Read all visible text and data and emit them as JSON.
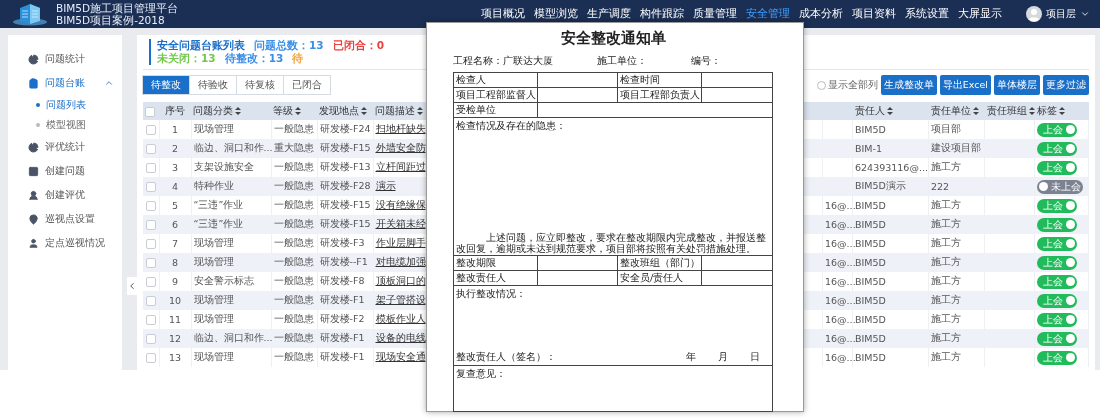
{
  "header": {
    "title": "BIM5D施工项目管理平台",
    "subtitle": "BIM5D项目案例-2018",
    "user": "项目层",
    "nav": [
      {
        "label": "项目概况",
        "selected": false
      },
      {
        "label": "模型浏览",
        "selected": false
      },
      {
        "label": "生产调度",
        "selected": false
      },
      {
        "label": "构件跟踪",
        "selected": false
      },
      {
        "label": "质量管理",
        "selected": false
      },
      {
        "label": "安全管理",
        "selected": true
      },
      {
        "label": "成本分析",
        "selected": false
      },
      {
        "label": "项目资料",
        "selected": false
      },
      {
        "label": "系统设置",
        "selected": false
      },
      {
        "label": "大屏显示",
        "selected": false
      }
    ]
  },
  "sidebar": [
    {
      "label": "问题统计",
      "selected": false,
      "expanded": false
    },
    {
      "label": "问题台账",
      "selected": false,
      "expanded": true,
      "children": [
        {
          "label": "问题列表",
          "selected": true
        },
        {
          "label": "模型视图",
          "selected": false
        }
      ]
    },
    {
      "label": "评优统计",
      "selected": false,
      "expanded": false
    },
    {
      "label": "创建问题",
      "selected": false,
      "expanded": false
    },
    {
      "label": "创建评优",
      "selected": false,
      "expanded": false
    },
    {
      "label": "巡视点设置",
      "selected": false,
      "expanded": false
    },
    {
      "label": "定点巡视情况",
      "selected": false,
      "expanded": false
    }
  ],
  "list": {
    "title": "安全问题台账列表",
    "stats": [
      {
        "label": "问题总数：13",
        "color": "#3a8ee6"
      },
      {
        "label": "已闭合：0",
        "color": "#e8423f"
      },
      {
        "label": "未关闭：13",
        "color": "#74c64c"
      },
      {
        "label": "待整改：13",
        "color": "#3a8ee6"
      },
      {
        "label": "待",
        "color": "#f2a23a"
      }
    ],
    "tabs": [
      {
        "label": "待整改",
        "selected": true
      },
      {
        "label": "待验收",
        "selected": false
      },
      {
        "label": "待复核",
        "selected": false
      },
      {
        "label": "已闭合",
        "selected": false
      }
    ],
    "show_all_columns": {
      "label": "显示全部列",
      "checked": false
    },
    "buttons": [
      "生成整改单",
      "导出Excel",
      "单体楼层",
      "更多过滤"
    ],
    "table": {
      "header_checked": false,
      "columns": [
        {
          "label": "序号",
          "sortable": false
        },
        {
          "label": "问题分类",
          "sortable": true
        },
        {
          "label": "等级",
          "sortable": true
        },
        {
          "label": "发现地点",
          "sortable": true
        },
        {
          "label": "问题描述",
          "sortable": true
        },
        {
          "label": "责任人",
          "sortable": true
        },
        {
          "label": "责任单位",
          "sortable": true
        },
        {
          "label": "责任班组",
          "sortable": true
        },
        {
          "label": "标签",
          "sortable": true
        }
      ],
      "rows": [
        {
          "checked": false,
          "cells": [
            "1",
            "现场管理",
            "一般隐患",
            "研发楼-F24",
            "扫地杆缺失"
          ],
          "assignee": "BIM5D",
          "unit": "项目部",
          "tag": {
            "label": "上会",
            "on": true
          }
        },
        {
          "checked": false,
          "cells": [
            "2",
            "临边、洞口和作...",
            "重大隐患",
            "研发楼-F15",
            "外墙安全防"
          ],
          "assignee": "BIM-1",
          "unit": "建设项目部",
          "tag": {
            "label": "上会",
            "on": true
          }
        },
        {
          "checked": false,
          "cells": [
            "3",
            "支架设施安全",
            "一般隐患",
            "研发楼-F13",
            "立杆间距过"
          ],
          "assignee": "624393116@...",
          "unit": "施工方",
          "tag": {
            "label": "上会",
            "on": true
          }
        },
        {
          "checked": false,
          "cells": [
            "4",
            "特种作业",
            "一般隐患",
            "研发楼-F28",
            "演示"
          ],
          "assignee": "BIM5D演示",
          "unit": "222",
          "tag": {
            "label": "未上会",
            "on": false
          }
        },
        {
          "checked": false,
          "cells": [
            "5",
            "“三违”作业",
            "一般隐患",
            "研发楼-F15",
            "没有绝缘保"
          ],
          "column_7": "16@...",
          "assignee": "BIM5D",
          "unit": "施工方",
          "tag": {
            "label": "上会",
            "on": true
          }
        },
        {
          "checked": false,
          "cells": [
            "6",
            "“三违”作业",
            "一般隐患",
            "研发楼-F15",
            "开关箱未经"
          ],
          "column_7": "16@...",
          "assignee": "BIM5D",
          "unit": "施工方",
          "tag": {
            "label": "上会",
            "on": true
          }
        },
        {
          "checked": false,
          "cells": [
            "7",
            "现场管理",
            "一般隐患",
            "研发楼-F3",
            "作业层脚手"
          ],
          "column_7": "16@...",
          "assignee": "BIM5D",
          "unit": "施工方",
          "tag": {
            "label": "上会",
            "on": true
          }
        },
        {
          "checked": false,
          "cells": [
            "8",
            "现场管理",
            "一般隐患",
            "研发楼--F1",
            "对电缆加强"
          ],
          "column_7": "16@...",
          "assignee": "BIM5D",
          "unit": "施工方",
          "tag": {
            "label": "上会",
            "on": true
          }
        },
        {
          "checked": false,
          "cells": [
            "9",
            "安全警示标志",
            "一般隐患",
            "研发楼-F8",
            "顶板洞口的"
          ],
          "column_7": "16@...",
          "assignee": "BIM5D",
          "unit": "施工方",
          "tag": {
            "label": "上会",
            "on": true
          }
        },
        {
          "checked": false,
          "cells": [
            "10",
            "现场管理",
            "一般隐患",
            "研发楼-F1",
            "架子管搭设"
          ],
          "column_7": "16@...",
          "assignee": "BIM5D",
          "unit": "施工方",
          "tag": {
            "label": "上会",
            "on": true
          }
        },
        {
          "checked": false,
          "cells": [
            "11",
            "现场管理",
            "一般隐患",
            "研发楼-F2",
            "模板作业人"
          ],
          "column_7": "16@...",
          "assignee": "BIM5D",
          "unit": "施工方",
          "tag": {
            "label": "上会",
            "on": true
          }
        },
        {
          "checked": false,
          "cells": [
            "12",
            "临边、洞口和作...",
            "一般隐患",
            "研发楼-F1",
            "设备的电线"
          ],
          "column_7": "16@...",
          "assignee": "BIM5D",
          "unit": "施工方",
          "tag": {
            "label": "上会",
            "on": true
          }
        },
        {
          "checked": false,
          "cells": [
            "13",
            "现场管理",
            "一般隐患",
            "研发楼-F1",
            "现场安全通"
          ],
          "column_7": "16@...",
          "assignee": "BIM5D",
          "unit": "施工方",
          "tag": {
            "label": "上会",
            "on": true
          }
        }
      ]
    }
  },
  "notice": {
    "title": "安全整改通知单",
    "meta": [
      "工程名称：广联达大厦",
      "施工单位：",
      "编号："
    ],
    "rows": [
      {
        "kind": "pair",
        "labels": [
          "检查人",
          "检查时间"
        ]
      },
      {
        "kind": "pair",
        "labels": [
          "项目工程部监督人",
          "项目工程部负责人"
        ]
      },
      {
        "kind": "single",
        "label": "受检单位"
      },
      {
        "kind": "area",
        "label": "检查情况及存在的隐患：",
        "note": "上述问题，应立即整改，要求在整改期限内完成整改，并报送整改回复，逾期或未达到规范要求，项目部将按照有关处罚措施处理。"
      },
      {
        "kind": "pair",
        "labels": [
          "整改期限",
          "整改班组（部门）"
        ]
      },
      {
        "kind": "pair",
        "labels": [
          "整改责任人",
          "安全员/责任人"
        ]
      },
      {
        "kind": "area",
        "label": "执行整改情况：",
        "sign": "整改责任人（签名）：",
        "date": [
          "年",
          "月",
          "日"
        ]
      },
      {
        "kind": "area",
        "label": "复查意见："
      }
    ]
  }
}
